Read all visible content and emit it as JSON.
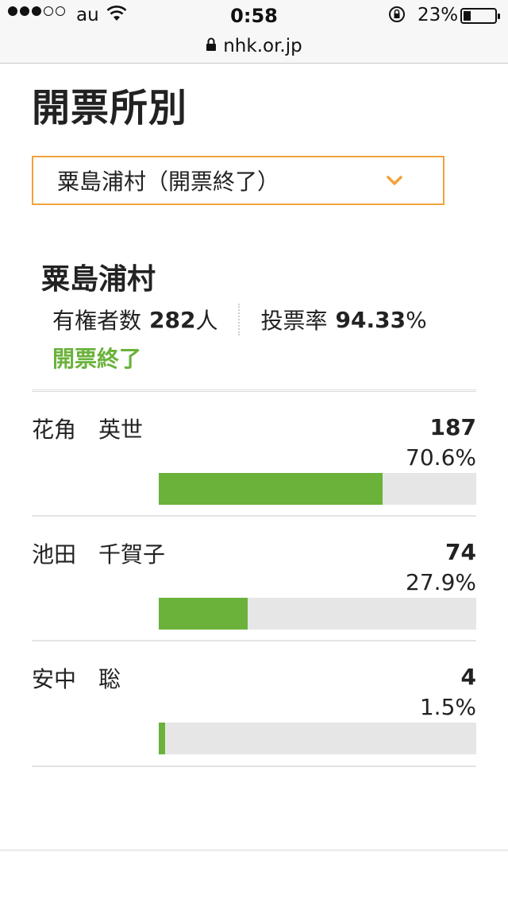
{
  "status_bar": {
    "carrier": "au",
    "time": "0:58",
    "battery_percent": "23%",
    "battery_level": 0.23,
    "signal_bars_filled": 3,
    "signal_bars_total": 5
  },
  "browser": {
    "url": "nhk.or.jp"
  },
  "page": {
    "title": "開票所別",
    "select_value": "粟島浦村（開票終了）"
  },
  "municipality": {
    "name": "粟島浦村",
    "voters_label": "有権者数",
    "voters_value": "282",
    "voters_unit": "人",
    "turnout_label": "投票率",
    "turnout_value": "94.33",
    "turnout_unit": "%",
    "status": "開票終了"
  },
  "candidates": [
    {
      "name": "花角　英世",
      "votes": "187",
      "percent": "70.6%",
      "share": 0.706
    },
    {
      "name": "池田　千賀子",
      "votes": "74",
      "percent": "27.9%",
      "share": 0.279
    },
    {
      "name": "安中　聡",
      "votes": "4",
      "percent": "1.5%",
      "share": 0.015
    }
  ],
  "colors": {
    "accent_orange": "#f0a33a",
    "bar_green": "#6ab23a",
    "status_green": "#6ab23a",
    "bar_track": "#e6e6e6"
  }
}
